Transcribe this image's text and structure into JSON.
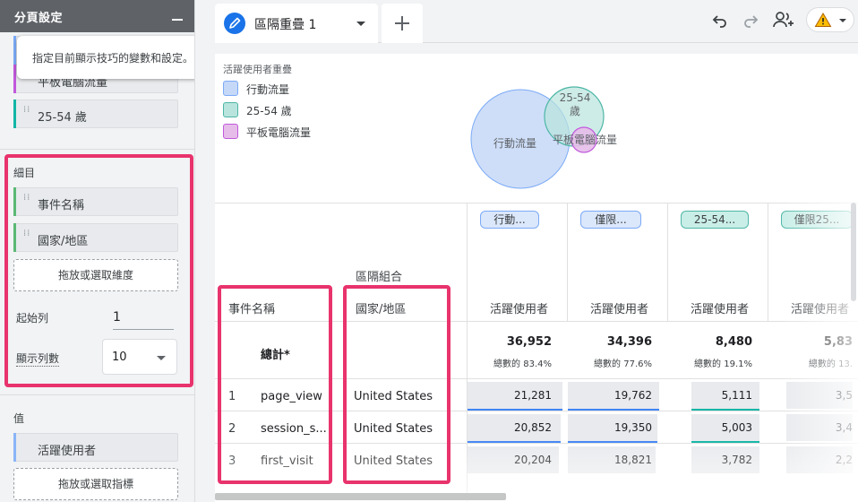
{
  "panel": {
    "title": "分頁設定",
    "tooltip": "指定目前顯示技巧的變數和設定。",
    "segments": [
      {
        "label": "平板電腦流量",
        "color": "#c158dc"
      },
      {
        "label": "25-54 歲",
        "color": "#12b5a6"
      }
    ],
    "breakdowns": {
      "title": "細目",
      "items": [
        {
          "label": "事件名稱",
          "color": "#5bb974"
        },
        {
          "label": "國家/地區",
          "color": "#5bb974"
        }
      ],
      "drop_label": "拖放或選取維度",
      "start_row_label": "起始列",
      "start_row_value": "1",
      "rows_label": "顯示列數",
      "rows_value": "10"
    },
    "values": {
      "title": "值",
      "items": [
        {
          "label": "活躍使用者",
          "color": "#8ab4f8"
        }
      ],
      "drop_label": "拖放或選取指標"
    }
  },
  "toolbar": {
    "tab_label": "區隔重疊 1",
    "icons": [
      "pencil-icon",
      "undo-icon",
      "redo-icon",
      "share-user-icon",
      "warning-icon"
    ]
  },
  "viz": {
    "title": "活躍使用者重疊",
    "legend": [
      {
        "label": "行動流量",
        "fill": "#c5d8f7",
        "stroke": "#7baaf7"
      },
      {
        "label": "25-54 歲",
        "fill": "#b9e4dd",
        "stroke": "#4db6a6"
      },
      {
        "label": "平板電腦流量",
        "fill": "#e6bde9",
        "stroke": "#c158dc"
      }
    ],
    "venn_labels": {
      "mobile": "行動流量",
      "age_line1": "25-54",
      "age_line2": "歲",
      "tablet": "平板電腦流量"
    }
  },
  "table": {
    "group_label": "區隔組合",
    "dim_headers": [
      "事件名稱",
      "國家/地區"
    ],
    "segment_chips": [
      {
        "label": "行動...",
        "fill": "#dbe7fb",
        "stroke": "#7baaf7"
      },
      {
        "label": "僅限...",
        "fill": "#dbe7fb",
        "stroke": "#7baaf7"
      },
      {
        "label": "25-54...",
        "fill": "#c9eee7",
        "stroke": "#4db6a6"
      },
      {
        "label": "僅限25...",
        "fill": "#c9eee7",
        "stroke": "#4db6a6"
      }
    ],
    "metric_header": "活躍使用者",
    "total_label": "總計*",
    "totals": [
      {
        "value": "36,952",
        "pct": "總數的 83.4%"
      },
      {
        "value": "34,396",
        "pct": "總數的 77.6%"
      },
      {
        "value": "8,480",
        "pct": "總數的 19.1%"
      },
      {
        "value": "5,83",
        "pct": "總數的 13."
      }
    ],
    "rows": [
      {
        "idx": "1",
        "event": "page_view",
        "country": "United States",
        "values": [
          "21,281",
          "19,762",
          "5,111",
          "3,5"
        ]
      },
      {
        "idx": "2",
        "event": "session_s...",
        "country": "United States",
        "values": [
          "20,852",
          "19,350",
          "5,003",
          "3,4"
        ]
      },
      {
        "idx": "3",
        "event": "first_visit",
        "country": "United States",
        "values": [
          "20,204",
          "18,821",
          "3,782",
          "2,2"
        ]
      }
    ]
  }
}
